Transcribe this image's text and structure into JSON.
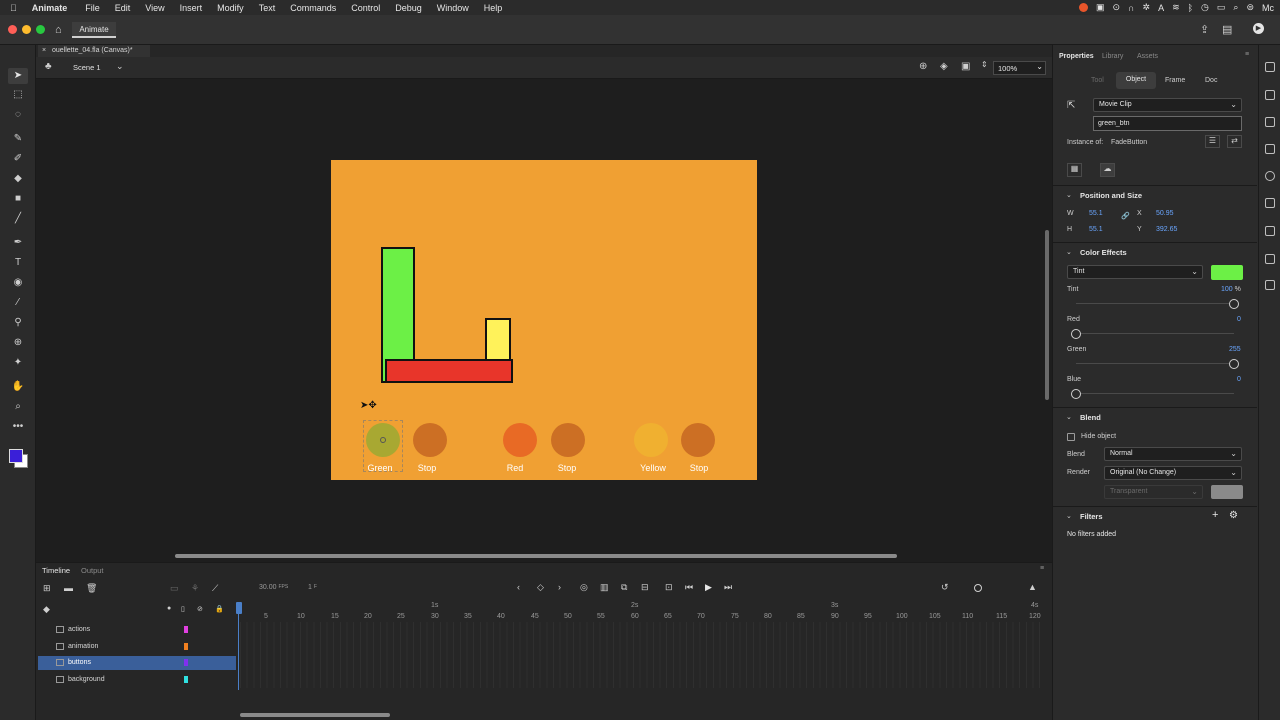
{
  "menubar": {
    "apple": "",
    "app_name": "Animate",
    "items": [
      "File",
      "Edit",
      "View",
      "Insert",
      "Modify",
      "Text",
      "Commands",
      "Control",
      "Debug",
      "Window",
      "Help"
    ],
    "right_text": "Mc"
  },
  "appbar": {
    "workspace_tab": "Animate"
  },
  "document": {
    "tab_title": "ouellette_04.fla (Canvas)*"
  },
  "scene": {
    "name": "Scene 1",
    "zoom": "100%"
  },
  "stage": {
    "background": "#f0a033",
    "buttons": [
      {
        "label": "Green",
        "color": "#a8a832"
      },
      {
        "label": "Stop",
        "color": "#cc6f24"
      },
      {
        "label": "Red",
        "color": "#e86a25"
      },
      {
        "label": "Stop",
        "color": "#cc6f24"
      },
      {
        "label": "Yellow",
        "color": "#f0b030"
      },
      {
        "label": "Stop",
        "color": "#cc6f24"
      }
    ],
    "shapes": {
      "green_bar": "#6cf046",
      "red_bar": "#e8352a",
      "yellow_bar": "#fff25a"
    }
  },
  "timeline": {
    "tabs": [
      "Timeline",
      "Output"
    ],
    "fps": "30.00",
    "fps_unit": "FPS",
    "current_frame": "1",
    "frame_unit": "F",
    "second_marks": [
      "1s",
      "2s",
      "3s",
      "4s"
    ],
    "frame_numbers": [
      "5",
      "10",
      "15",
      "20",
      "25",
      "30",
      "35",
      "40",
      "45",
      "50",
      "55",
      "60",
      "65",
      "70",
      "75",
      "80",
      "85",
      "90",
      "95",
      "100",
      "105",
      "110",
      "115",
      "120"
    ],
    "layers": [
      {
        "name": "actions",
        "color": "#e040e0",
        "selected": false
      },
      {
        "name": "animation",
        "color": "#f08020",
        "selected": false
      },
      {
        "name": "buttons",
        "color": "#8030f0",
        "selected": true
      },
      {
        "name": "background",
        "color": "#30e0e0",
        "selected": false
      }
    ]
  },
  "panel": {
    "tabs": [
      "Properties",
      "Library",
      "Assets"
    ],
    "subtabs": [
      "Tool",
      "Object",
      "Frame",
      "Doc"
    ],
    "symbol_type": "Movie Clip",
    "instance_name": "green_btn",
    "instance_of_label": "Instance of:",
    "instance_of_value": "FadeButton",
    "position_size": {
      "title": "Position and Size",
      "w_label": "W",
      "w": "55.1",
      "h_label": "H",
      "h": "55.1",
      "x_label": "X",
      "x": "50.95",
      "y_label": "Y",
      "y": "392.65"
    },
    "color_effects": {
      "title": "Color Effects",
      "style": "Tint",
      "swatch": "#6cf046",
      "tint_label": "Tint",
      "tint": "100",
      "tint_unit": "%",
      "red_label": "Red",
      "red": "0",
      "green_label": "Green",
      "green": "255",
      "blue_label": "Blue",
      "blue": "0"
    },
    "blend": {
      "title": "Blend",
      "hide_object": "Hide object",
      "blend_label": "Blend",
      "blend_value": "Normal",
      "render_label": "Render",
      "render_value": "Original (No Change)",
      "transparent": "Transparent"
    },
    "filters": {
      "title": "Filters",
      "empty": "No filters added"
    }
  }
}
